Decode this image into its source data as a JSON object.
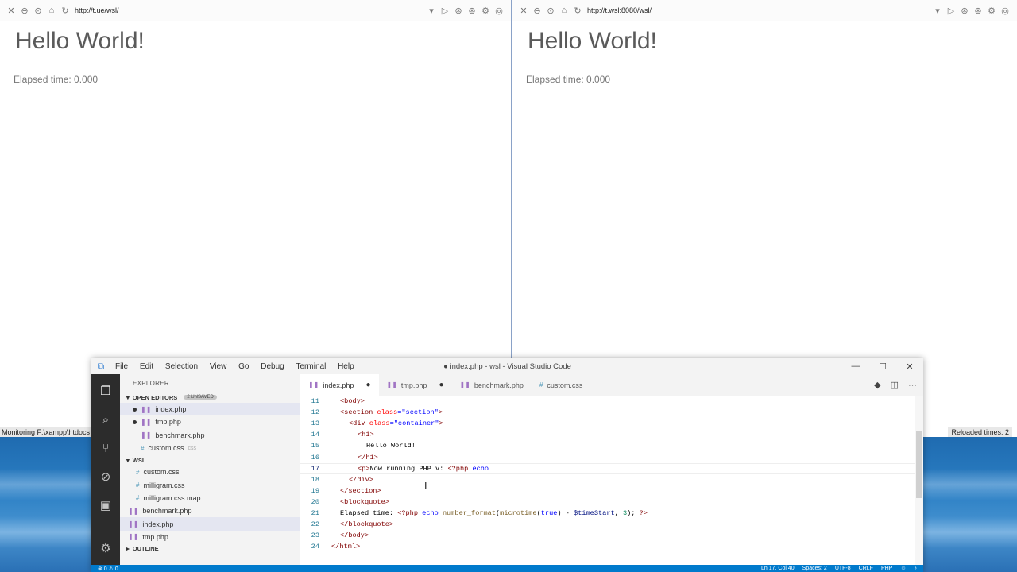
{
  "browser_left": {
    "url": "http://t.ue/wsl/",
    "title": "Hello World!",
    "elapsed": "Elapsed time: 0.000",
    "status_text": "Monitoring F:\\xampp\\htdocs"
  },
  "browser_right": {
    "url": "http://t.wsl:8080/wsl/",
    "title": "Hello World!",
    "elapsed": "Elapsed time: 0.000",
    "status_text": "Reloaded times:  2"
  },
  "vscode": {
    "window_title": "● index.php - wsl - Visual Studio Code",
    "menu": [
      "File",
      "Edit",
      "Selection",
      "View",
      "Go",
      "Debug",
      "Terminal",
      "Help"
    ],
    "window_controls": {
      "minimize": "—",
      "maximize": "☐",
      "close": "✕"
    },
    "sidebar": {
      "header": "EXPLORER",
      "open_editors": "OPEN EDITORS",
      "unsaved_badge": "2 UNSAVED",
      "open_files": [
        {
          "name": "index.php",
          "icon": "php-icon",
          "modified": true
        },
        {
          "name": "tmp.php",
          "icon": "php-icon",
          "modified": true
        },
        {
          "name": "benchmark.php",
          "icon": "php-icon",
          "modified": false
        },
        {
          "name": "custom.css",
          "icon": "css-icon",
          "ext": "css",
          "modified": false
        }
      ],
      "folder": "WSL",
      "folder_files": [
        {
          "name": "custom.css",
          "icon": "css-icon"
        },
        {
          "name": "milligram.css",
          "icon": "css-icon"
        },
        {
          "name": "milligram.css.map",
          "icon": "css-icon"
        },
        {
          "name": "benchmark.php",
          "icon": "php-icon"
        },
        {
          "name": "index.php",
          "icon": "php-icon"
        },
        {
          "name": "tmp.php",
          "icon": "php-icon"
        }
      ],
      "outline": "OUTLINE"
    },
    "tabs": [
      {
        "name": "index.php",
        "modified": true,
        "active": true
      },
      {
        "name": "tmp.php",
        "modified": true,
        "active": false
      },
      {
        "name": "benchmark.php",
        "modified": false,
        "active": false
      },
      {
        "name": "custom.css",
        "modified": false,
        "active": false
      }
    ],
    "code_lines": [
      {
        "n": "11"
      },
      {
        "n": "12"
      },
      {
        "n": "13"
      },
      {
        "n": "14"
      },
      {
        "n": "15"
      },
      {
        "n": "16"
      },
      {
        "n": "17"
      },
      {
        "n": "18"
      },
      {
        "n": "19"
      },
      {
        "n": "20"
      },
      {
        "n": "21"
      },
      {
        "n": "22"
      },
      {
        "n": "23"
      },
      {
        "n": "24"
      }
    ],
    "code": {
      "l11": "<body>",
      "l12a": "<section ",
      "l12b": "class",
      "l12c": "=\"section\"",
      "l12d": ">",
      "l13a": "<div ",
      "l13b": "class",
      "l13c": "=\"container\"",
      "l13d": ">",
      "l14": "<h1>",
      "l15": "Hello World!",
      "l16": "</h1>",
      "l17a": "<p>",
      "l17b": "Now running PHP v: ",
      "l17c": "<?php",
      "l17d": " echo ",
      "l18": "</div>",
      "l19": "</section>",
      "l20": "<blockquote>",
      "l21a": "Elapsed time: ",
      "l21b": "<?php",
      "l21c": " echo ",
      "l21d": "number_format",
      "l21e": "(",
      "l21f": "microtime",
      "l21g": "(",
      "l21h": "true",
      "l21i": ") - ",
      "l21j": "$timeStart",
      "l21k": ", ",
      "l21l": "3",
      "l21m": "); ",
      "l21n": "?>",
      "l22": "</blockquote>",
      "l23": "</body>",
      "l24": "</html>"
    },
    "status": {
      "left": "⊗ 0  ⚠ 0",
      "position": "Ln 17, Col 40",
      "spaces": "Spaces: 2",
      "encoding": "UTF-8",
      "eol": "CRLF",
      "language": "PHP"
    }
  },
  "colors": {
    "accent": "#007acc",
    "php": "#a074c4",
    "css": "#519aba"
  }
}
